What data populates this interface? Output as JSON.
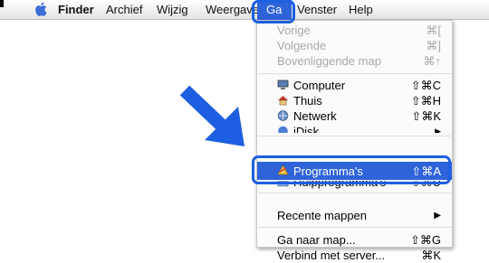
{
  "menubar": {
    "apple_icon": "apple-icon",
    "items": [
      "Finder",
      "Archief",
      "Wijzig",
      "Weergave",
      "Ga",
      "Venster",
      "Help"
    ],
    "active": "Ga"
  },
  "go_menu": {
    "back": {
      "label": "Vorige",
      "shortcut": "⌘["
    },
    "forward": {
      "label": "Volgende",
      "shortcut": "⌘]"
    },
    "enclosing": {
      "label": "Bovenliggende map",
      "shortcut": "⌘↑"
    },
    "computer": {
      "label": "Computer",
      "shortcut": "⇧⌘C",
      "icon": "computer-icon"
    },
    "home": {
      "label": "Thuis",
      "shortcut": "⇧⌘H",
      "icon": "home-icon"
    },
    "network": {
      "label": "Netwerk",
      "shortcut": "⇧⌘K",
      "icon": "network-icon"
    },
    "idisk": {
      "label": "iDisk",
      "icon": "idisk-icon"
    },
    "applications": {
      "label": "Programma's",
      "shortcut": "⇧⌘A",
      "icon": "applications-icon"
    },
    "utilities": {
      "label": "Hulpprogramma's",
      "shortcut": "⇧⌘U",
      "icon": "utilities-icon"
    },
    "recent": {
      "label": "Recente mappen"
    },
    "goto": {
      "label": "Ga naar map...",
      "shortcut": "⇧⌘G"
    },
    "connect": {
      "label": "Verbind met server...",
      "shortcut": "⌘K"
    }
  },
  "colors": {
    "highlight": "#2f63d9",
    "annotation": "#1d5fe0"
  }
}
